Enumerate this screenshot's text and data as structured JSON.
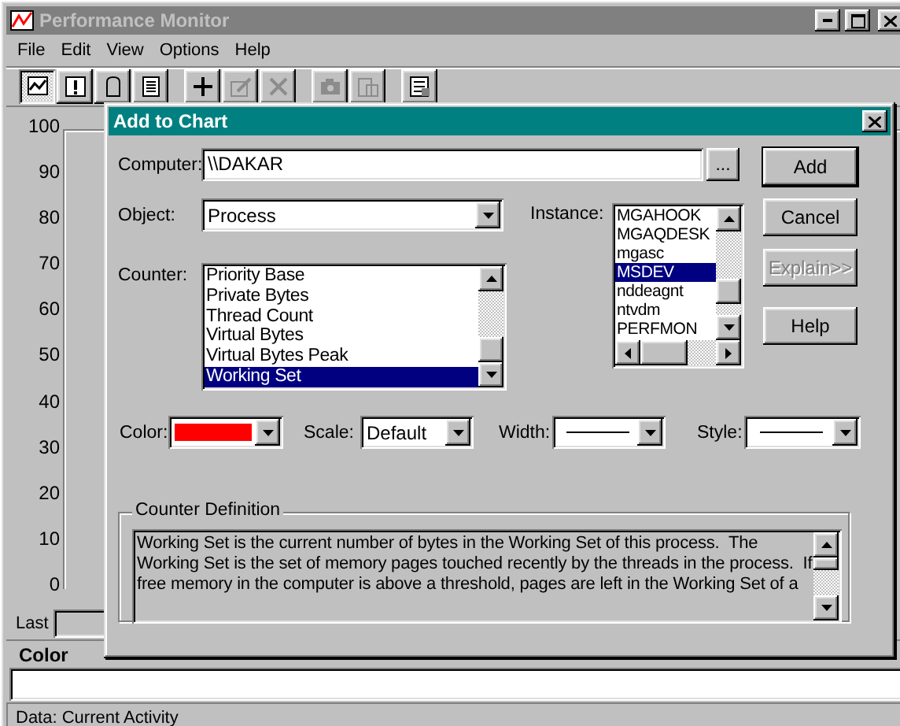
{
  "main_window": {
    "title": "Performance Monitor",
    "menu": [
      {
        "label": "File"
      },
      {
        "label": "Edit"
      },
      {
        "label": "View"
      },
      {
        "label": "Options"
      },
      {
        "label": "Help"
      }
    ],
    "toolbar": [
      [
        {
          "kind": "chart",
          "pressed": true,
          "disabled": false
        },
        {
          "kind": "alert",
          "pressed": false,
          "disabled": false
        },
        {
          "kind": "log",
          "pressed": false,
          "disabled": false
        },
        {
          "kind": "report",
          "pressed": false,
          "disabled": false
        }
      ],
      [
        {
          "kind": "add",
          "pressed": false,
          "disabled": false
        },
        {
          "kind": "edit",
          "pressed": false,
          "disabled": true
        },
        {
          "kind": "delete",
          "pressed": false,
          "disabled": true
        }
      ],
      [
        {
          "kind": "camera",
          "pressed": false,
          "disabled": true
        },
        {
          "kind": "export",
          "pressed": false,
          "disabled": true
        }
      ],
      [
        {
          "kind": "options",
          "pressed": false,
          "disabled": false
        }
      ]
    ],
    "y_axis_labels": [
      "100",
      "90",
      "80",
      "70",
      "60",
      "50",
      "40",
      "30",
      "20",
      "10",
      "0"
    ],
    "last_label": "Last",
    "legend_header": "Color",
    "status": "Data: Current Activity"
  },
  "dialog": {
    "title": "Add to Chart",
    "computer": {
      "label": "Computer:",
      "value": "\\\\DAKAR"
    },
    "browse_button": "...",
    "object": {
      "label": "Object:",
      "value": "Process"
    },
    "instance": {
      "label": "Instance:",
      "items": [
        {
          "text": "MGAHOOK",
          "selected": false
        },
        {
          "text": "MGAQDESK",
          "selected": false
        },
        {
          "text": "mgasc",
          "selected": false
        },
        {
          "text": "MSDEV",
          "selected": true
        },
        {
          "text": "nddeagnt",
          "selected": false
        },
        {
          "text": "ntvdm",
          "selected": false
        },
        {
          "text": "PERFMON",
          "selected": false
        }
      ]
    },
    "counter": {
      "label": "Counter:",
      "items": [
        {
          "text": "Priority Base",
          "selected": false
        },
        {
          "text": "Private Bytes",
          "selected": false
        },
        {
          "text": "Thread Count",
          "selected": false
        },
        {
          "text": "Virtual Bytes",
          "selected": false
        },
        {
          "text": "Virtual Bytes Peak",
          "selected": false
        },
        {
          "text": "Working Set",
          "selected": true
        }
      ]
    },
    "buttons": [
      {
        "label": "Add",
        "disabled": false,
        "default": true
      },
      {
        "label": "Cancel",
        "disabled": false,
        "default": false
      },
      {
        "label": "Explain>>",
        "disabled": true,
        "default": false
      },
      {
        "label": "Help",
        "disabled": false,
        "default": false
      }
    ],
    "color": {
      "label": "Color:",
      "color": "#ff0000"
    },
    "scale": {
      "label": "Scale:",
      "value": "Default"
    },
    "width": {
      "label": "Width:"
    },
    "style": {
      "label": "Style:"
    },
    "definition": {
      "title": "Counter Definition",
      "lines": [
        "Working Set is the current number of bytes in the Working Set of this process.  The",
        "Working Set is the set of memory pages touched recently by the threads in the process.  If",
        "free memory in the computer is above a threshold, pages are left in the Working Set of a"
      ]
    }
  }
}
